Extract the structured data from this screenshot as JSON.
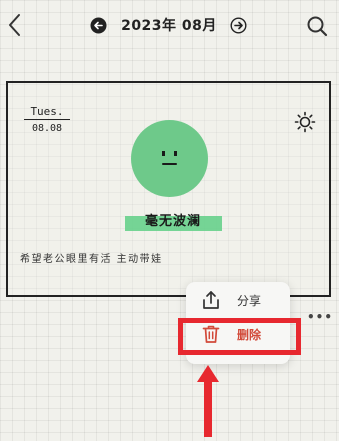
{
  "header": {
    "month_label": "2023年 08月",
    "icons": [
      "back-icon",
      "prev-month-icon",
      "next-month-icon",
      "search-icon"
    ]
  },
  "entry": {
    "weekday": "Tues.",
    "date": "08.08",
    "weather_icon": "sun-icon",
    "mood_icon": "neutral-face-icon",
    "mood_label": "毫无波澜",
    "text": "希望老公眼里有活 主动带娃"
  },
  "context_menu": {
    "items": [
      {
        "label": "分享",
        "icon": "share-icon"
      },
      {
        "label": "删除",
        "icon": "trash-icon"
      }
    ]
  },
  "more_icon": "more-dots-icon",
  "annotation": {
    "highlight_color": "#e7282f",
    "pointer_icon": "up-arrow-icon"
  },
  "colors": {
    "background": "#f1f1ec",
    "mood_green": "#6ec98a",
    "delete_red": "#d24a3a",
    "annotation_red": "#e7282f"
  }
}
